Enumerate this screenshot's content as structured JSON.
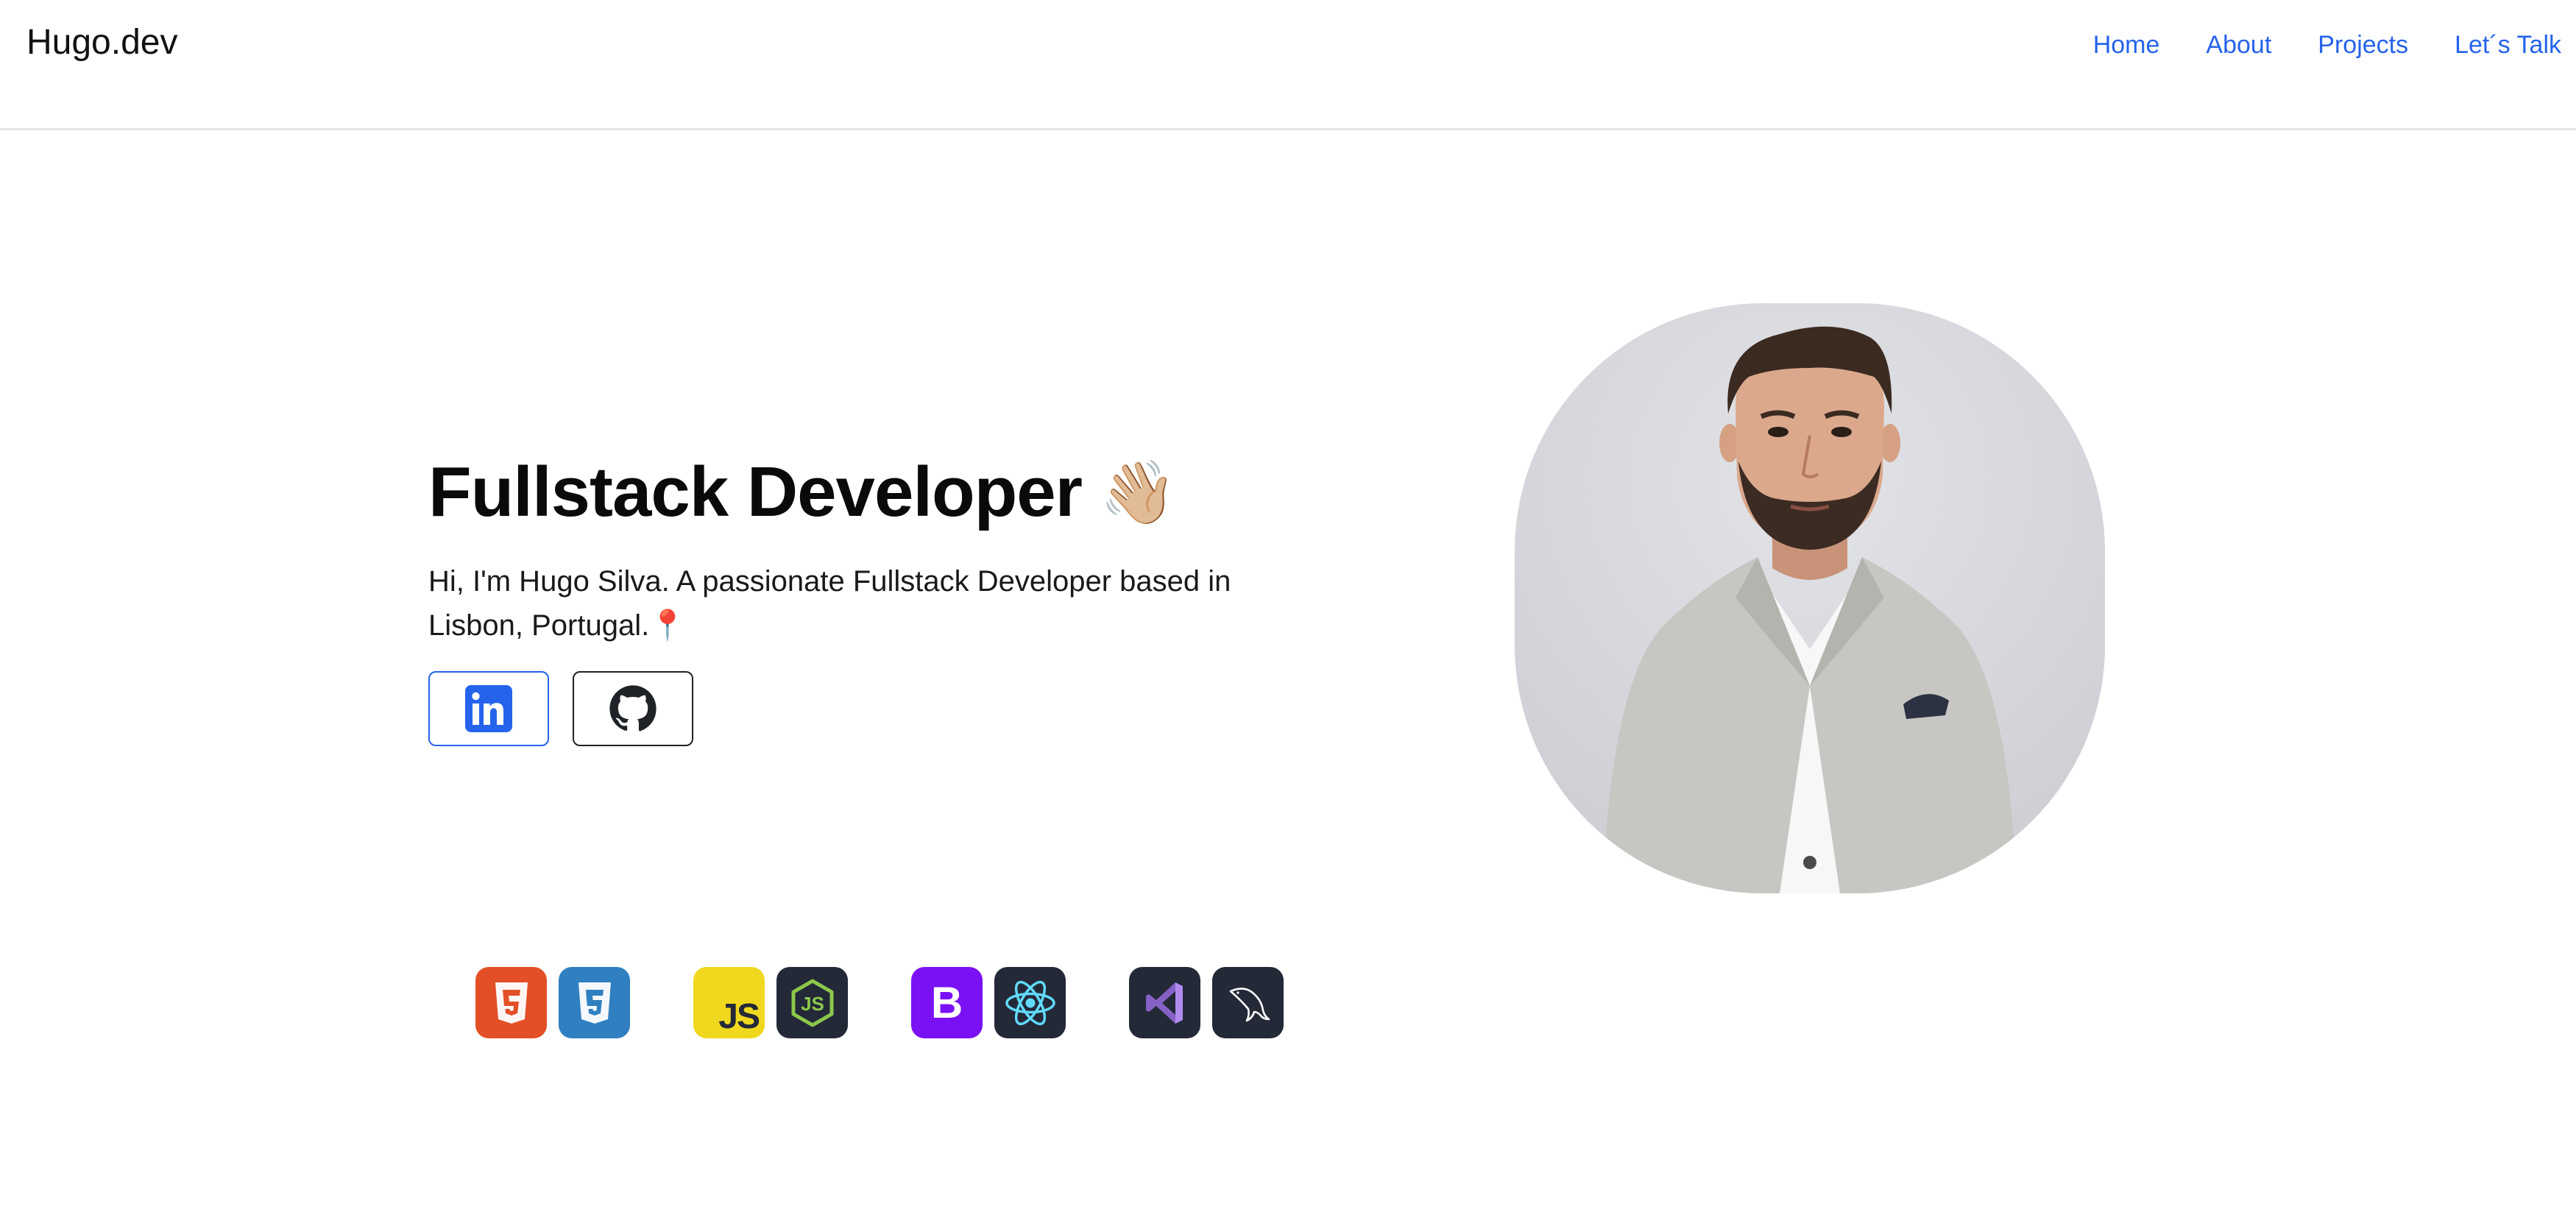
{
  "header": {
    "brand": "Hugo.dev",
    "nav": [
      "Home",
      "About",
      "Projects",
      "Let´s Talk"
    ]
  },
  "hero": {
    "title": "Fullstack Developer",
    "wave_emoji": "👋🏼",
    "description": "Hi, I'm Hugo Silva. A passionate Fullstack Developer based in Lisbon, Portugal.📍",
    "social": [
      {
        "name": "linkedin-icon",
        "color": "#2563eb"
      },
      {
        "name": "github-icon",
        "color": "#222222"
      }
    ],
    "portrait_icon": "portrait-photo"
  },
  "tech_stack": [
    {
      "icon": "html5-icon",
      "color": "#e34f26"
    },
    {
      "icon": "css3-icon",
      "color": "#2f7fc1"
    },
    {
      "icon": "javascript-icon",
      "color": "#efd81d",
      "text": "JS"
    },
    {
      "icon": "nodejs-icon",
      "color": "#242938"
    },
    {
      "icon": "bootstrap-icon",
      "color": "#7a11f5",
      "text": "B"
    },
    {
      "icon": "react-icon",
      "color": "#242938"
    },
    {
      "icon": "visual-studio-icon",
      "color": "#242938"
    },
    {
      "icon": "mysql-icon",
      "color": "#242938"
    }
  ],
  "colors": {
    "accent": "#2563eb",
    "text": "#111111",
    "divider": "#e5e5e5"
  }
}
